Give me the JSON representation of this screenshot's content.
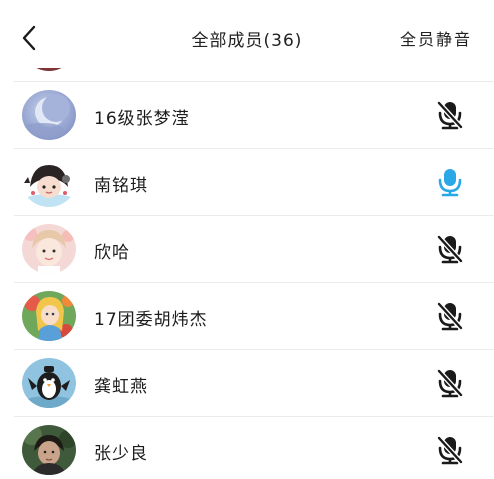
{
  "header": {
    "title": "全部成员(36)",
    "mute_all_label": "全员静音"
  },
  "members": [
    {
      "name": "16级张梦滢",
      "mic": "muted",
      "avatar": "moon-avatar"
    },
    {
      "name": "南铭琪",
      "mic": "active",
      "avatar": "cartoon-girl-avatar"
    },
    {
      "name": "欣哈",
      "mic": "muted",
      "avatar": "boy-portrait-avatar"
    },
    {
      "name": "17团委胡炜杰",
      "mic": "muted",
      "avatar": "alice-cartoon-avatar"
    },
    {
      "name": "龚虹燕",
      "mic": "muted",
      "avatar": "penguin-avatar"
    },
    {
      "name": "张少良",
      "mic": "muted",
      "avatar": "man-photo-avatar"
    }
  ],
  "colors": {
    "mic_active": "#2aa7e6",
    "mic_muted": "#1a1a1a",
    "divider": "#ebebeb"
  }
}
